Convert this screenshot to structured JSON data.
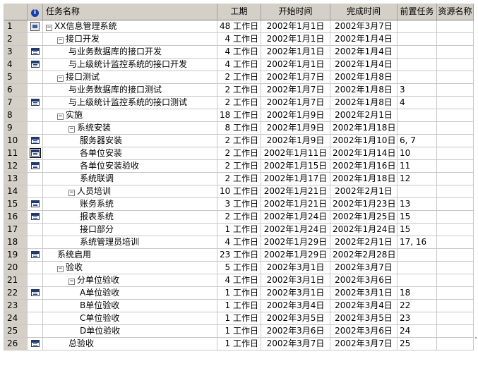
{
  "header": {
    "indicator_glyph": "i",
    "name": "任务名称",
    "duration": "工期",
    "start": "开始时间",
    "finish": "完成时间",
    "predecessors": "前置任务",
    "resources": "资源名称"
  },
  "tasks": [
    {
      "id": "1",
      "indicator": "task-icon",
      "level": 0,
      "toggle": "−",
      "name": "XX信息管理系统",
      "duration": "48 工作日",
      "start": "2002年1月1日",
      "finish": "2002年3月7日",
      "pred": "",
      "res": ""
    },
    {
      "id": "2",
      "indicator": "",
      "level": 1,
      "toggle": "−",
      "name": "接口开发",
      "duration": "4 工作日",
      "start": "2002年1月1日",
      "finish": "2002年1月4日",
      "pred": "",
      "res": ""
    },
    {
      "id": "3",
      "indicator": "note-icon",
      "level": 2,
      "toggle": "",
      "name": "与业务数据库的接口开发",
      "duration": "4 工作日",
      "start": "2002年1月1日",
      "finish": "2002年1月4日",
      "pred": "",
      "res": ""
    },
    {
      "id": "4",
      "indicator": "note-icon",
      "level": 2,
      "toggle": "",
      "name": "与上级统计监控系统的接口开发",
      "duration": "4 工作日",
      "start": "2002年1月1日",
      "finish": "2002年1月4日",
      "pred": "",
      "res": ""
    },
    {
      "id": "5",
      "indicator": "",
      "level": 1,
      "toggle": "−",
      "name": "接口测试",
      "duration": "2 工作日",
      "start": "2002年1月7日",
      "finish": "2002年1月8日",
      "pred": "",
      "res": ""
    },
    {
      "id": "6",
      "indicator": "",
      "level": 2,
      "toggle": "",
      "name": "与业务数据库的接口测试",
      "duration": "2 工作日",
      "start": "2002年1月7日",
      "finish": "2002年1月8日",
      "pred": "3",
      "res": ""
    },
    {
      "id": "7",
      "indicator": "note-icon",
      "level": 2,
      "toggle": "",
      "name": "与上级统计监控系统的接口测试",
      "duration": "2 工作日",
      "start": "2002年1月7日",
      "finish": "2002年1月8日",
      "pred": "4",
      "res": ""
    },
    {
      "id": "8",
      "indicator": "",
      "level": 1,
      "toggle": "−",
      "name": "实施",
      "duration": "18 工作日",
      "start": "2002年1月9日",
      "finish": "2002年2月1日",
      "pred": "",
      "res": ""
    },
    {
      "id": "9",
      "indicator": "",
      "level": 2,
      "toggle": "−",
      "name": "系统安装",
      "duration": "8 工作日",
      "start": "2002年1月9日",
      "finish": "2002年1月18日",
      "pred": "",
      "res": ""
    },
    {
      "id": "10",
      "indicator": "note-icon",
      "level": 3,
      "toggle": "",
      "name": "服务器安装",
      "duration": "2 工作日",
      "start": "2002年1月9日",
      "finish": "2002年1月10日",
      "pred": "6, 7",
      "res": ""
    },
    {
      "id": "11",
      "indicator": "note-icon-selected",
      "level": 3,
      "toggle": "",
      "name": "各单位安装",
      "duration": "2 工作日",
      "start": "2002年1月11日",
      "finish": "2002年1月14日",
      "pred": "10",
      "res": ""
    },
    {
      "id": "12",
      "indicator": "note-icon",
      "level": 3,
      "toggle": "",
      "name": "各单位安装验收",
      "duration": "2 工作日",
      "start": "2002年1月15日",
      "finish": "2002年1月16日",
      "pred": "11",
      "res": ""
    },
    {
      "id": "13",
      "indicator": "",
      "level": 3,
      "toggle": "",
      "name": "系统联调",
      "duration": "2 工作日",
      "start": "2002年1月17日",
      "finish": "2002年1月18日",
      "pred": "12",
      "res": ""
    },
    {
      "id": "14",
      "indicator": "",
      "level": 2,
      "toggle": "−",
      "name": "人员培训",
      "duration": "10 工作日",
      "start": "2002年1月21日",
      "finish": "2002年2月1日",
      "pred": "",
      "res": ""
    },
    {
      "id": "15",
      "indicator": "note-icon",
      "level": 3,
      "toggle": "",
      "name": "账务系统",
      "duration": "3 工作日",
      "start": "2002年1月21日",
      "finish": "2002年1月23日",
      "pred": "13",
      "res": ""
    },
    {
      "id": "16",
      "indicator": "note-icon",
      "level": 3,
      "toggle": "",
      "name": "报表系统",
      "duration": "2 工作日",
      "start": "2002年1月24日",
      "finish": "2002年1月25日",
      "pred": "15",
      "res": ""
    },
    {
      "id": "17",
      "indicator": "",
      "level": 3,
      "toggle": "",
      "name": "接口部分",
      "duration": "1 工作日",
      "start": "2002年1月24日",
      "finish": "2002年1月24日",
      "pred": "15",
      "res": ""
    },
    {
      "id": "18",
      "indicator": "",
      "level": 3,
      "toggle": "",
      "name": "系统管理员培训",
      "duration": "4 工作日",
      "start": "2002年1月29日",
      "finish": "2002年2月1日",
      "pred": "17, 16",
      "res": ""
    },
    {
      "id": "19",
      "indicator": "note-icon",
      "level": 1,
      "toggle": "",
      "name": "系统启用",
      "duration": "23 工作日",
      "start": "2002年1月29日",
      "finish": "2002年2月28日",
      "pred": "",
      "res": ""
    },
    {
      "id": "20",
      "indicator": "",
      "level": 1,
      "toggle": "−",
      "name": "验收",
      "duration": "5 工作日",
      "start": "2002年3月1日",
      "finish": "2002年3月7日",
      "pred": "",
      "res": ""
    },
    {
      "id": "21",
      "indicator": "",
      "level": 2,
      "toggle": "−",
      "name": "分单位验收",
      "duration": "4 工作日",
      "start": "2002年3月1日",
      "finish": "2002年3月6日",
      "pred": "",
      "res": ""
    },
    {
      "id": "22",
      "indicator": "note-icon",
      "level": 3,
      "toggle": "",
      "name": "A单位验收",
      "duration": "1 工作日",
      "start": "2002年3月1日",
      "finish": "2002年3月1日",
      "pred": "18",
      "res": ""
    },
    {
      "id": "23",
      "indicator": "",
      "level": 3,
      "toggle": "",
      "name": "B单位验收",
      "duration": "1 工作日",
      "start": "2002年3月4日",
      "finish": "2002年3月4日",
      "pred": "22",
      "res": ""
    },
    {
      "id": "24",
      "indicator": "",
      "level": 3,
      "toggle": "",
      "name": "C单位验收",
      "duration": "1 工作日",
      "start": "2002年3月5日",
      "finish": "2002年3月5日",
      "pred": "23",
      "res": ""
    },
    {
      "id": "25",
      "indicator": "",
      "level": 3,
      "toggle": "",
      "name": "D单位验收",
      "duration": "1 工作日",
      "start": "2002年3月6日",
      "finish": "2002年3月6日",
      "pred": "24",
      "res": ""
    },
    {
      "id": "26",
      "indicator": "note-icon",
      "level": 2,
      "toggle": "",
      "name": "总验收",
      "duration": "1 工作日",
      "start": "2002年3月7日",
      "finish": "2002年3月7日",
      "pred": "25",
      "res": ""
    }
  ],
  "colors": {
    "header_bg": "#d4d0c8",
    "gridline": "#c8c8c8",
    "icon_blue": "#1e3a6e"
  }
}
